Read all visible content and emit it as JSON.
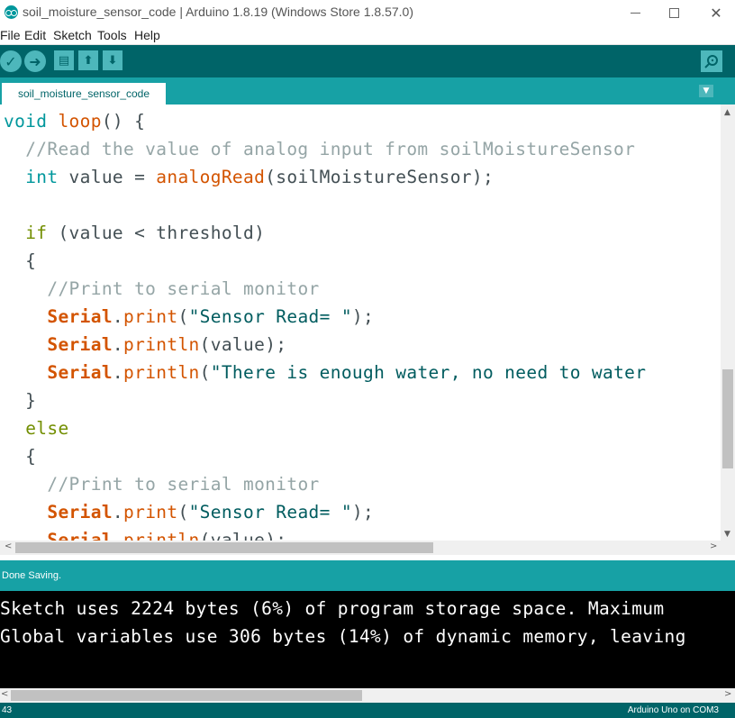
{
  "window": {
    "title": "soil_moisture_sensor_code | Arduino 1.8.19 (Windows Store 1.8.57.0)",
    "controls": {
      "minimize": "—",
      "maximize": "☐",
      "close": "✕"
    }
  },
  "menu": {
    "items": [
      "File",
      "Edit",
      "Sketch",
      "Tools",
      "Help"
    ]
  },
  "toolbar": {
    "buttons": [
      {
        "name": "verify",
        "icon": "checkmark-icon",
        "glyph": "✓"
      },
      {
        "name": "upload",
        "icon": "arrow-right-icon",
        "glyph": "➜"
      },
      {
        "name": "new",
        "icon": "document-icon",
        "glyph": "▤"
      },
      {
        "name": "open",
        "icon": "arrow-up-icon",
        "glyph": "⬆"
      },
      {
        "name": "save",
        "icon": "arrow-down-icon",
        "glyph": "⬇"
      },
      {
        "name": "serial-monitor",
        "icon": "magnifier-icon"
      }
    ]
  },
  "tabs": {
    "active": "soil_moisture_sensor_code",
    "menu_glyph": "▼"
  },
  "editor": {
    "lines": [
      [
        {
          "t": "void",
          "c": "kw-type"
        },
        {
          "t": " "
        },
        {
          "t": "loop",
          "c": "kw-func"
        },
        {
          "t": "() {"
        }
      ],
      [
        {
          "t": "  "
        },
        {
          "t": "//Read the value of analog input from soilMoistureSensor",
          "c": "comment"
        }
      ],
      [
        {
          "t": "  "
        },
        {
          "t": "int",
          "c": "kw-type"
        },
        {
          "t": " value = "
        },
        {
          "t": "analogRead",
          "c": "kw-func"
        },
        {
          "t": "(soilMoistureSensor);"
        }
      ],
      [
        {
          "t": ""
        }
      ],
      [
        {
          "t": "  "
        },
        {
          "t": "if",
          "c": "kw-ctrl"
        },
        {
          "t": " (value < threshold)"
        }
      ],
      [
        {
          "t": "  {"
        }
      ],
      [
        {
          "t": "    "
        },
        {
          "t": "//Print to serial monitor",
          "c": "comment"
        }
      ],
      [
        {
          "t": "    "
        },
        {
          "t": "Serial",
          "c": "kw-class"
        },
        {
          "t": "."
        },
        {
          "t": "print",
          "c": "kw-func"
        },
        {
          "t": "("
        },
        {
          "t": "\"Sensor Read= \"",
          "c": "str"
        },
        {
          "t": ");"
        }
      ],
      [
        {
          "t": "    "
        },
        {
          "t": "Serial",
          "c": "kw-class"
        },
        {
          "t": "."
        },
        {
          "t": "println",
          "c": "kw-func"
        },
        {
          "t": "(value);"
        }
      ],
      [
        {
          "t": "    "
        },
        {
          "t": "Serial",
          "c": "kw-class"
        },
        {
          "t": "."
        },
        {
          "t": "println",
          "c": "kw-func"
        },
        {
          "t": "("
        },
        {
          "t": "\"There is enough water, no need to water",
          "c": "str"
        }
      ],
      [
        {
          "t": "  }"
        }
      ],
      [
        {
          "t": "  "
        },
        {
          "t": "else",
          "c": "kw-ctrl"
        }
      ],
      [
        {
          "t": "  {"
        }
      ],
      [
        {
          "t": "    "
        },
        {
          "t": "//Print to serial monitor",
          "c": "comment"
        }
      ],
      [
        {
          "t": "    "
        },
        {
          "t": "Serial",
          "c": "kw-class"
        },
        {
          "t": "."
        },
        {
          "t": "print",
          "c": "kw-func"
        },
        {
          "t": "("
        },
        {
          "t": "\"Sensor Read= \"",
          "c": "str"
        },
        {
          "t": ");"
        }
      ],
      [
        {
          "t": "    "
        },
        {
          "t": "Serial",
          "c": "kw-class"
        },
        {
          "t": "."
        },
        {
          "t": "println",
          "c": "kw-func"
        },
        {
          "t": "(value);"
        }
      ]
    ]
  },
  "status": {
    "message": "Done Saving."
  },
  "console": {
    "lines": [
      "Sketch uses 2224 bytes (6%) of program storage space. Maximum",
      "Global variables use 306 bytes (14%) of dynamic memory, leaving"
    ]
  },
  "footer": {
    "line_number": "43",
    "board": "Arduino Uno on COM3"
  },
  "scroll_arrows": {
    "up": "▲",
    "down": "▼",
    "left": "<",
    "right": ">"
  },
  "colors": {
    "toolbar": "#006468",
    "tabbar": "#17a1a5",
    "button": "#4db7bb",
    "keyword_type": "#00979c",
    "keyword_ctrl": "#728e00",
    "function": "#d35400",
    "comment": "#95a5a6",
    "string": "#005c5f"
  }
}
